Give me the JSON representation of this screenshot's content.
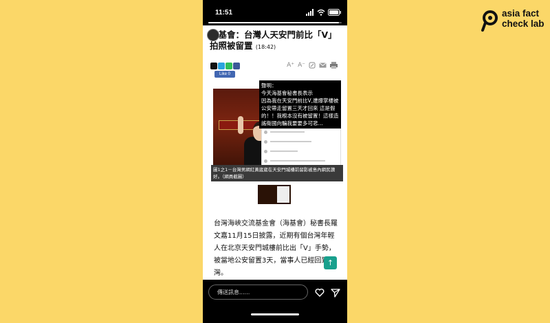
{
  "status_bar": {
    "time": "11:51"
  },
  "story": {
    "progress": 0.98,
    "headline": "海基會：台灣人天安門前比「V」拍照被留置",
    "headline_time": "(18:42)",
    "like_label": "Like 0",
    "tools": {
      "font_larger": "A⁺",
      "font_smaller": "A⁻"
    },
    "quote_text": "聲明：\n今天海基會秘書長表示\n因為我在天安門前比V,遭爆掌樓被公安帶走留置三天才回來 這是假的！！我根本沒有被留置！這樣造謠衛國向騙我要要多可悲…",
    "caption": "圖1之1－台灣男網紅黃崴崴在天安門城樓前留影被島內網民讚好。（網員截圖）",
    "body": "台灣海峽交流基金會（海基會）秘書長羅文嘉11月15日披露，近期有個台灣年輕人在北京天安門城樓前比出「V」手勢，被當地公安留置3天，當事人已經回到台灣。",
    "scroll_top_icon": "↑"
  },
  "reply": {
    "placeholder": "傳送訊息......"
  },
  "brand": {
    "line1": "asia fact",
    "line2": "check lab"
  },
  "colors": {
    "background": "#fbd768",
    "accent": "#19a08d",
    "like": "#4267b2"
  },
  "icons": [
    "signal-icon",
    "wifi-icon",
    "battery-icon",
    "close-icon",
    "heart-icon",
    "send-icon",
    "print-icon",
    "email-icon",
    "link-icon"
  ]
}
